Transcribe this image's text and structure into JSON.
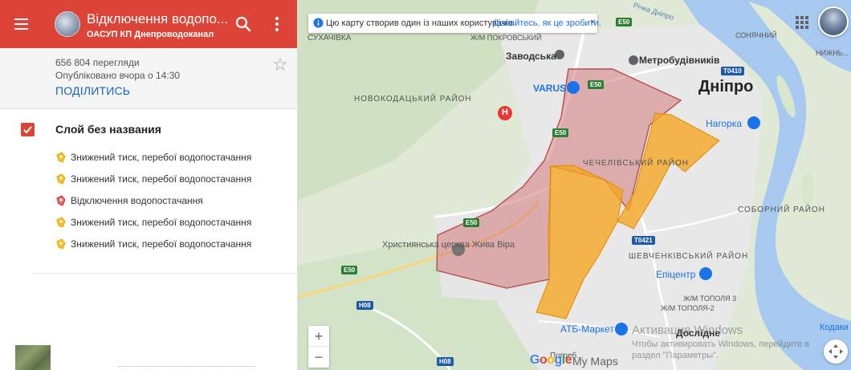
{
  "header": {
    "title": "Відключення водопо...",
    "subtitle": "ОАСУП КП Днепроводоканал",
    "menu_icon": "menu-icon",
    "search_icon": "search-icon",
    "more_icon": "more-vert-icon"
  },
  "meta": {
    "views": "656 804 перегляди",
    "published": "Опубліковано вчора о 14:30",
    "share_label": "ПОДІЛИТИСЬ"
  },
  "layer": {
    "title": "Слой без названия",
    "checked": true,
    "items": [
      {
        "label": "Знижений тиск, перебої водопостачання",
        "color": "#f9a825",
        "icon": "yellow-pin-icon"
      },
      {
        "label": "Знижений тиск, перебої водопостачання",
        "color": "#f9a825",
        "icon": "yellow-pin-icon"
      },
      {
        "label": "Відключення водопостачання",
        "color": "#e57373",
        "icon": "red-pin-icon"
      },
      {
        "label": "Знижений тиск, перебої водопостачання",
        "color": "#f9a825",
        "icon": "yellow-pin-icon"
      },
      {
        "label": "Знижений тиск, перебої водопостачання",
        "color": "#f9a825",
        "icon": "yellow-pin-icon"
      }
    ]
  },
  "map": {
    "banner_text": "Цю карту створив один із наших користувачів.",
    "banner_link": "Дізнайтесь, як це зробити.",
    "banner_close": "×",
    "labels": {
      "sukhachivka": "СУХАЧІВКА",
      "pokrovsky": "Ж/М ПОКРОВСЬКИЙ",
      "zavodska": "Заводська",
      "metrobud": "Метробудівників",
      "novokodatsky": "НОВОКОДАЦЬКИЙ РАЙОН",
      "varus": "VARUS",
      "dnipro": "Дніпро",
      "nahorka": "Нагорка",
      "chechelivsky": "ЧЕЧЕЛІВСЬКИЙ РАЙОН",
      "sobornyi": "СОБОРНИЙ РАЙОН",
      "church": "Християнська церква Жива Віра",
      "shevchenkivsky": "ШЕВЧЕНКІВСЬКИЙ РАЙОН",
      "epicentr": "Епіцентр",
      "topolia3": "Ж/М ТОПОЛЯ 3",
      "topolia2": "Ж/М ТОПОЛЯ-2",
      "atb": "АТБ-Маркет",
      "doslidne": "Дослідне",
      "pogreg": "Погреб...",
      "sonyachnyi": "СОНЯЧНИЙ",
      "nyzhni": "НИЖНЬ...",
      "kodaky": "Кодаки",
      "river": "Річка Дніпро",
      "e50_a": "E50",
      "e50_b": "E50",
      "e50_c": "E50",
      "e50_d": "E50",
      "e50_e": "E50",
      "t0410": "T0410",
      "t0421": "T0421",
      "h08_a": "H08",
      "h08_b": "H08",
      "n_marker": "H"
    },
    "zoom_in": "+",
    "zoom_out": "−",
    "logo_parts": [
      "G",
      "o",
      "o",
      "g",
      "l",
      "e"
    ],
    "mymaps": "My Maps",
    "activate_title": "Активация Windows",
    "activate_desc": "Чтобы активировать Windows, перейдите в раздел \"Параметры\".",
    "colors": {
      "red_zone": "#d17a7a",
      "orange_zone": "#f5a623",
      "header": "#db4437",
      "link": "#1a73e8",
      "water": "#a8c9ef"
    }
  }
}
